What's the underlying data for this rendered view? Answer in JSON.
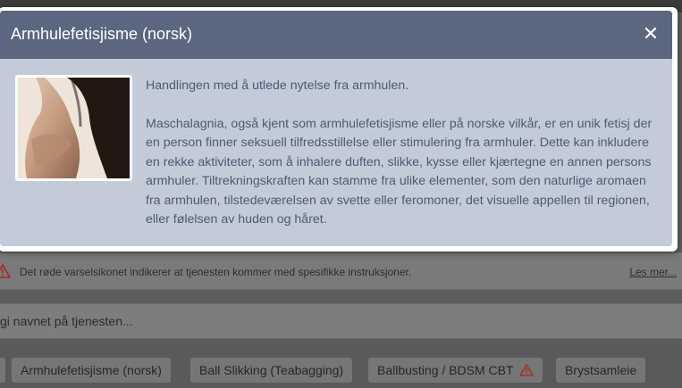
{
  "modal": {
    "title": "Armhulefetisjisme (norsk)",
    "close_glyph": "✕",
    "image_alt": "photo",
    "paragraphs": [
      "Handlingen med å utlede nytelse fra armhulen.",
      "Maschalagnia, også kjent som armhulefetisjisme eller på norske vilkår, er en unik fetisj der en person finner seksuell tilfredsstillelse eller stimulering fra armhuler. Dette kan inkludere en rekke aktiviteter, som å inhalere duften, slikke, kysse eller kjærtegne en annen persons armhuler. Tiltrekningskraften kan stamme fra ulike elementer, som den naturlige aromaen fra armhulen, tilstedeværelsen av svette eller feromoner, det visuelle appellen til regionen, eller følelsen av huden og håret."
    ]
  },
  "notice": {
    "text": "Det røde varselsikonet indikerer at tjenesten kommer med spesifikke instruksjoner.",
    "link": "Les mer..."
  },
  "search": {
    "placeholder": "gi navnet på tjenesten..."
  },
  "tags": [
    {
      "label": "Armhulefetisjisme (norsk)",
      "warning": false
    },
    {
      "label": "Ball Slikking (Teabagging)",
      "warning": false
    },
    {
      "label": "Ballbusting / BDSM CBT",
      "warning": true
    },
    {
      "label": "Brystsamleie",
      "warning": false
    }
  ],
  "colors": {
    "modal_header": "#5b6780",
    "modal_body_bg": "#c4cbd8",
    "body_text": "#4e5a73",
    "warning_red": "#c0392b"
  }
}
